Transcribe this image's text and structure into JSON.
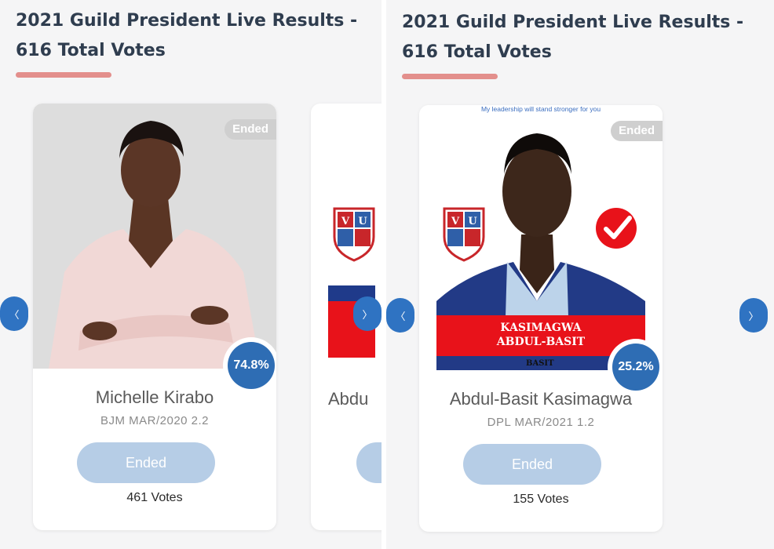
{
  "header": {
    "title": "2021 Guild President Live Results - 616 Total Votes"
  },
  "status_label": "Ended",
  "colors": {
    "accent_underline": "#e38f8c",
    "percent_blue": "#2e6db4",
    "ended_button": "#b6cde6",
    "nav_button": "#2f73c2",
    "banner_red": "#e8121a"
  },
  "icons": {
    "nav_prev": "chevron-left-icon",
    "nav_next": "chevron-right-icon",
    "university_logo": "vu-shield-icon",
    "checkmark": "check-badge-icon"
  },
  "candidates": [
    {
      "name": "Michelle Kirabo",
      "meta": "BJM MAR/2020 2.2",
      "percent": "74.8%",
      "votes": "461 Votes",
      "button_label": "Ended"
    },
    {
      "name": "Abdul-Basit Kasimagwa",
      "meta": "DPL MAR/2021 1.2",
      "percent": "25.2%",
      "votes": "155 Votes",
      "button_label": "Ended",
      "poster": {
        "slogan": "My leadership will stand stronger for you",
        "banner_line1": "KASIMAGWA",
        "banner_line2": "ABDUL-BASIT",
        "tag": "BASIT"
      }
    }
  ],
  "peek_card": {
    "name_fragment": "Abdu"
  }
}
